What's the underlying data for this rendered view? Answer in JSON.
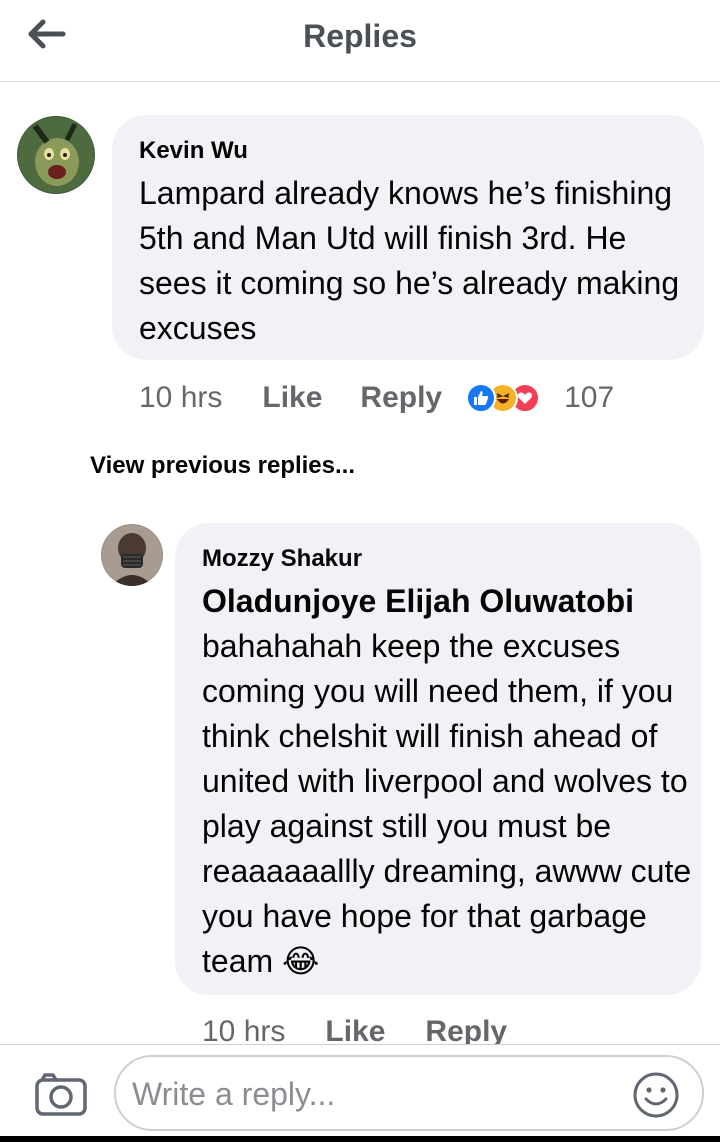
{
  "header": {
    "title": "Replies",
    "back_icon": "arrow-left-icon"
  },
  "comment": {
    "author": "Kevin Wu",
    "text": "Lampard already knows he’s finishing 5th and Man Utd will finish 3rd. He sees it coming so he’s already making excuses",
    "time": "10 hrs",
    "like_label": "Like",
    "reply_label": "Reply",
    "reaction_count": "107",
    "reaction_icons": [
      "like-reaction-icon",
      "haha-reaction-icon",
      "love-reaction-icon"
    ]
  },
  "view_previous_label": "View previous replies...",
  "reply": {
    "author": "Mozzy Shakur",
    "mention": "Oladunjoye Elijah Oluwatobi",
    "text": "bahahahah keep the excuses coming you will need them, if you think chelshit will finish ahead of united with liverpool and wolves to play against still you must be reaaaaaallly dreaming, awww cute you have hope for that garbage team",
    "emoji": "😂",
    "time": "10 hrs",
    "like_label": "Like",
    "reply_label": "Reply"
  },
  "composer": {
    "placeholder": "Write a reply...",
    "camera_icon": "camera-icon",
    "emoji_icon": "smiley-icon"
  },
  "colors": {
    "bubble": "#f0f2f5",
    "meta_text": "#65676b",
    "like_blue": "#1877f2",
    "love_red": "#f33e58",
    "haha_yellow": "#f7b125"
  }
}
